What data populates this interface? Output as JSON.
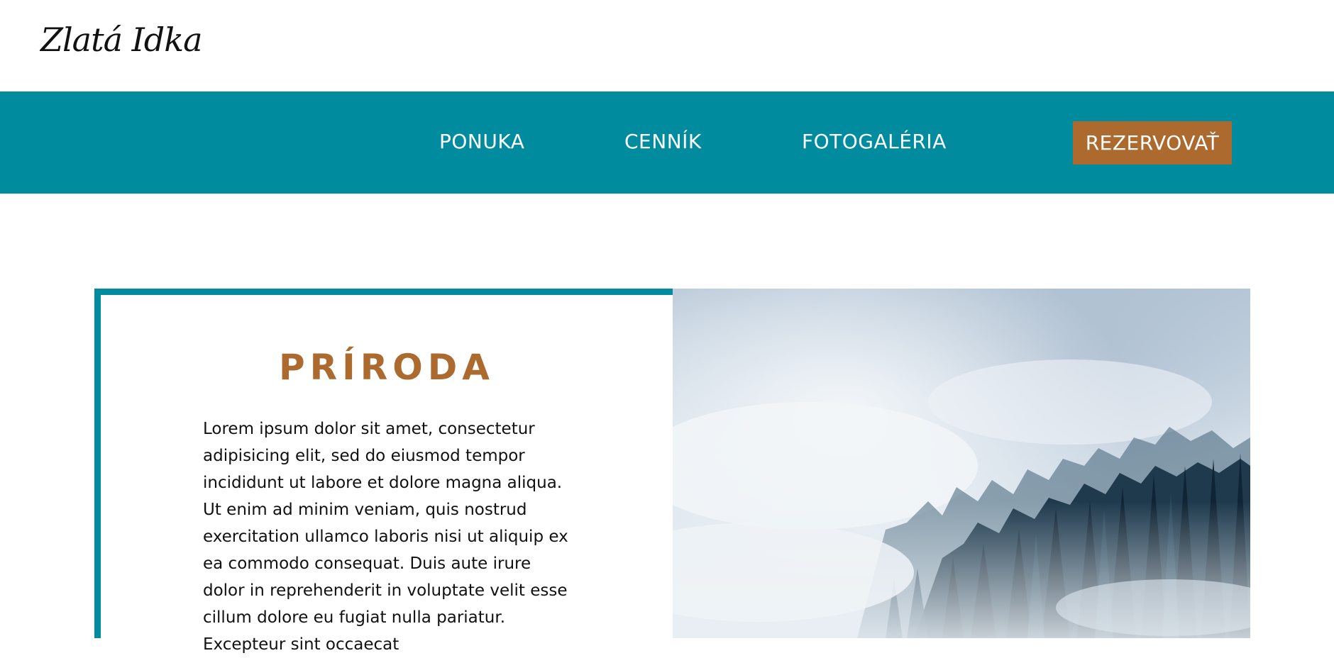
{
  "header": {
    "logo_text": "Zlatá Idka"
  },
  "nav": {
    "items": [
      {
        "label": "PONUKA"
      },
      {
        "label": "CENNÍK"
      },
      {
        "label": "FOTOGALÉRIA"
      }
    ],
    "cta_label": "REZERVOVAŤ"
  },
  "section": {
    "title": "PRÍRODA",
    "body": "Lorem ipsum dolor sit amet, consectetur adipisicing elit, sed do eiusmod tempor incididunt ut labore et dolore magna aliqua. Ut enim ad minim veniam, quis nostrud exercitation ullamco laboris nisi ut aliquip ex ea commodo consequat. Duis aute irure dolor in reprehenderit in voluptate velit esse cillum dolore eu fugiat nulla pariatur. Excepteur sint occaecat"
  },
  "colors": {
    "teal": "#008c9e",
    "copper": "#ac6a2f",
    "white": "#ffffff",
    "text": "#111111"
  }
}
